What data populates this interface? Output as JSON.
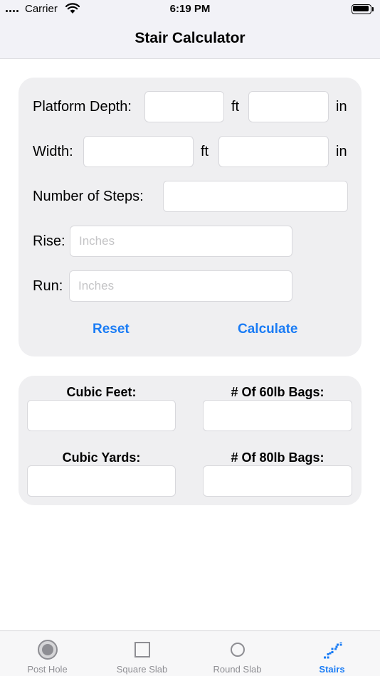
{
  "status_bar": {
    "carrier": "Carrier",
    "time": "6:19 PM"
  },
  "nav": {
    "title": "Stair Calculator"
  },
  "form": {
    "platform_depth_label": "Platform Depth:",
    "width_label": "Width:",
    "ft_unit": "ft",
    "in_unit": "in",
    "steps_label": "Number of Steps:",
    "rise_label": "Rise:",
    "rise_placeholder": "Inches",
    "run_label": "Run:",
    "run_placeholder": "Inches",
    "reset_label": "Reset",
    "calculate_label": "Calculate"
  },
  "results": {
    "cubic_feet_label": "Cubic Feet:",
    "bags_60_label": "# Of 60lb Bags:",
    "cubic_yards_label": "Cubic Yards:",
    "bags_80_label": "# Of 80lb Bags:"
  },
  "tabs": [
    {
      "label": "Post Hole",
      "icon": "post-hole-icon",
      "active": false
    },
    {
      "label": "Square Slab",
      "icon": "square-slab-icon",
      "active": false
    },
    {
      "label": "Round Slab",
      "icon": "round-slab-icon",
      "active": false
    },
    {
      "label": "Stairs",
      "icon": "stairs-icon",
      "active": true
    }
  ],
  "colors": {
    "accent": "#1a7cf5",
    "inactive": "#8e8e93",
    "card": "#efeff1",
    "bar": "#f2f2f7"
  }
}
